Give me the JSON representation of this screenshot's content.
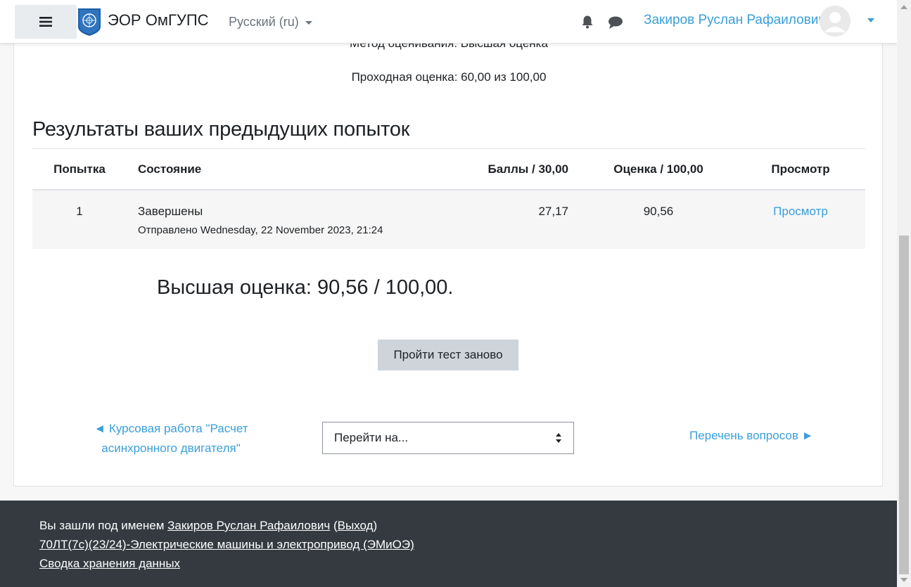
{
  "navbar": {
    "site_name": "ЭОР ОмГУПС",
    "language": "Русский (ru)",
    "user_name": "Закиров Руслан Рафаилович",
    "icons": [
      "menu-icon",
      "logo-icon",
      "bell-icon",
      "chat-icon",
      "avatar-icon"
    ]
  },
  "quiz": {
    "grading_method": "Метод оценивания: Высшая оценка",
    "passing_grade": "Проходная оценка: 60,00 из 100,00",
    "results_title": "Результаты ваших предыдущих попыток",
    "table": {
      "headers": [
        "Попытка",
        "Состояние",
        "Баллы / 30,00",
        "Оценка / 100,00",
        "Просмотр"
      ],
      "rows": [
        {
          "attempt": "1",
          "state": "Завершены",
          "submitted": "Отправлено Wednesday, 22 November 2023, 21:24",
          "marks": "27,17",
          "grade": "90,56",
          "review": "Просмотр"
        }
      ]
    },
    "best_grade": "Высшая оценка: 90,56 / 100,00.",
    "retry_button": "Пройти тест заново"
  },
  "activity_nav": {
    "prev_link": "◄ Курсовая работа \"Расчет асинхронного двигателя\"",
    "jump_placeholder": "Перейти на...",
    "next_link": "Перечень вопросов ►"
  },
  "footer": {
    "logged_in_prefix": "Вы зашли под именем ",
    "user_name": "Закиров Руслан Рафаилович",
    "logout_open": " (",
    "logout": "Выход",
    "logout_close": ")",
    "course_link": "70ЛТ(7с)(23/24)-Электрические машины и электропривод (ЭМиОЭ)",
    "data_retention": "Сводка хранения данных"
  },
  "colors": {
    "link": "#3a9fd8",
    "footer_bg": "#343a40",
    "button_bg": "#ced4da"
  }
}
